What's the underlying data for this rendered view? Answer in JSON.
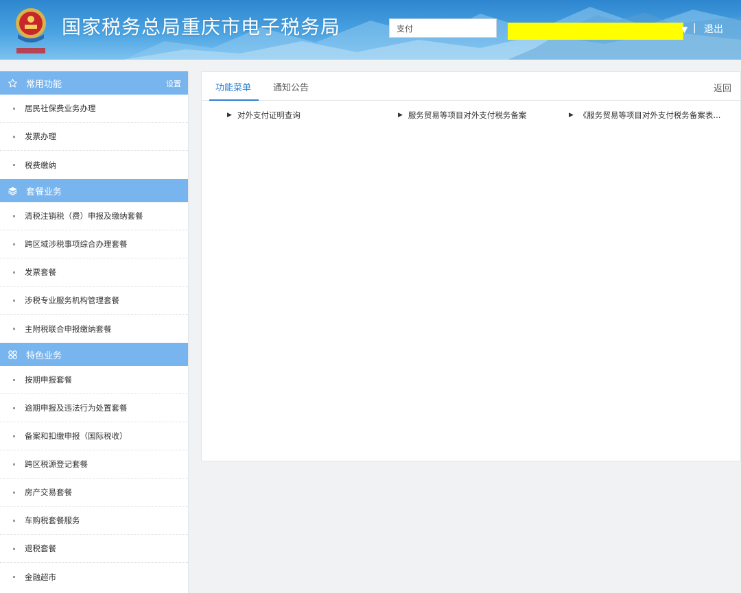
{
  "header": {
    "title": "国家税务总局重庆市电子税务局",
    "search_value": "支付",
    "logout_label": "退出",
    "divider": "|",
    "caret": "▼",
    "logo_icon": "tax-emblem-icon"
  },
  "sidebar": {
    "sections": [
      {
        "title": "常用功能",
        "icon": "star-icon",
        "settings_label": "设置",
        "items": [
          "居民社保费业务办理",
          "发票办理",
          "税费缴纳"
        ]
      },
      {
        "title": "套餐业务",
        "icon": "layers-icon",
        "items": [
          "清税注销税（费）申报及缴纳套餐",
          "跨区域涉税事项综合办理套餐",
          "发票套餐",
          "涉税专业服务机构管理套餐",
          "主附税联合申报缴纳套餐"
        ]
      },
      {
        "title": "特色业务",
        "icon": "grid-icon",
        "items": [
          "按期申报套餐",
          "逾期申报及违法行为处置套餐",
          "备案和扣缴申报（国际税收）",
          "跨区税源登记套餐",
          "房产交易套餐",
          "车购税套餐服务",
          "退税套餐",
          "金融超市"
        ]
      }
    ]
  },
  "main": {
    "tabs": [
      "功能菜单",
      "通知公告"
    ],
    "active_tab": 0,
    "back_label": "返回",
    "menu_links": [
      "对外支付证明查询",
      "服务贸易等项目对外支付税务备案",
      "《服务贸易等项目对外支付税务备案表..."
    ],
    "link_marker": "▶"
  },
  "colors": {
    "header_blue": "#2e86cf",
    "sidebar_section": "#78b5ee",
    "active_tab": "#2d7fd3",
    "user_highlight": "#ffff00"
  }
}
